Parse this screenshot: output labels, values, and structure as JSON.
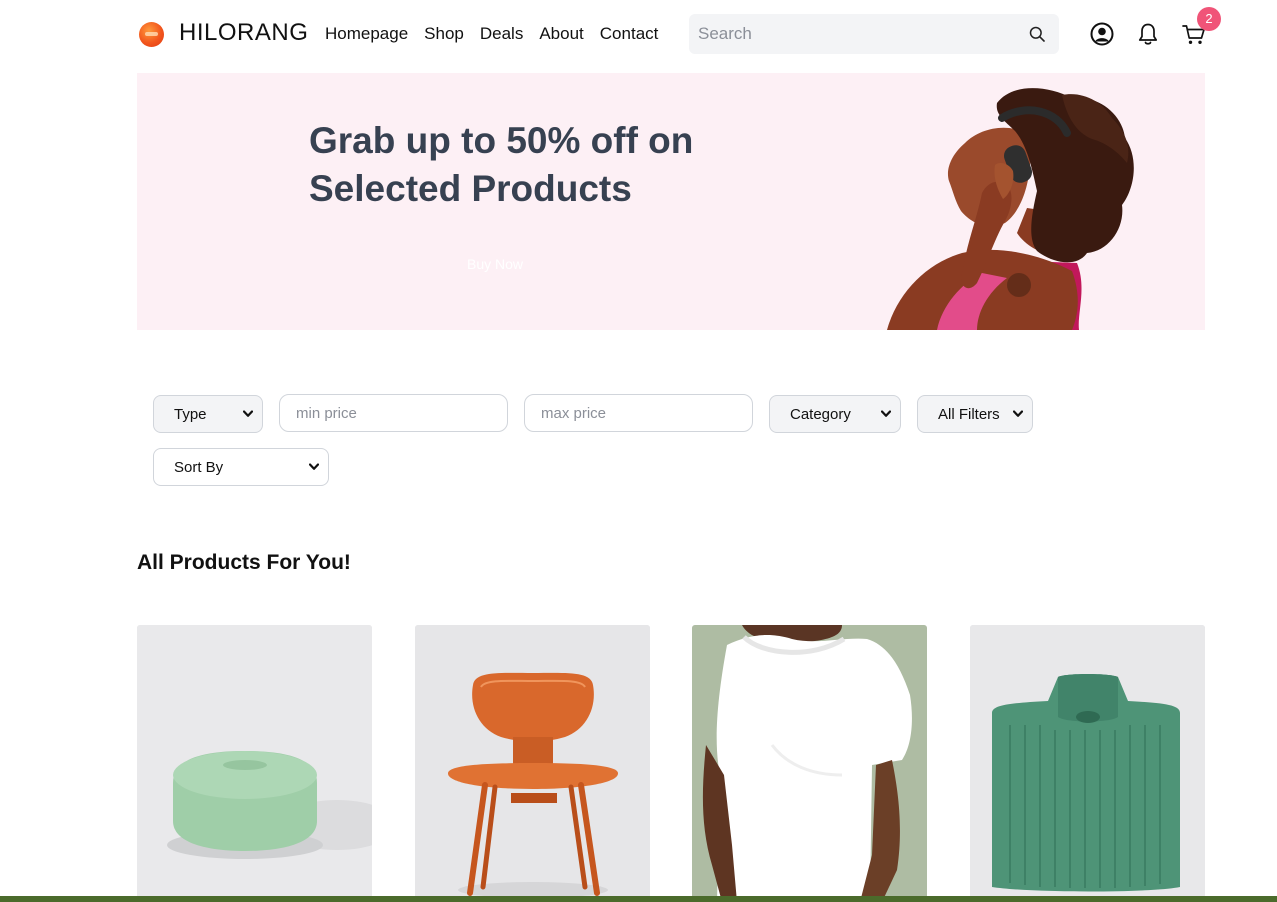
{
  "header": {
    "brand": "HILORANG",
    "nav": [
      "Homepage",
      "Shop",
      "Deals",
      "About",
      "Contact"
    ],
    "search_placeholder": "Search",
    "cart_count": "2"
  },
  "hero": {
    "title": "Grab up to 50% off on Selected Products",
    "button_label": "Buy Now"
  },
  "filters": {
    "type": "Type",
    "min_price_placeholder": "min price",
    "max_price_placeholder": "max price",
    "category": "Category",
    "all_filters": "All Filters",
    "sort_by": "Sort By"
  },
  "section_title": "All Products For You!",
  "products": [
    {
      "name": "green-ottoman"
    },
    {
      "name": "wooden-chair"
    },
    {
      "name": "white-tshirt"
    },
    {
      "name": "green-sweater"
    }
  ],
  "colors": {
    "hero_bg": "#fdf0f5",
    "badge": "#f05478",
    "hero_text": "#374151"
  }
}
